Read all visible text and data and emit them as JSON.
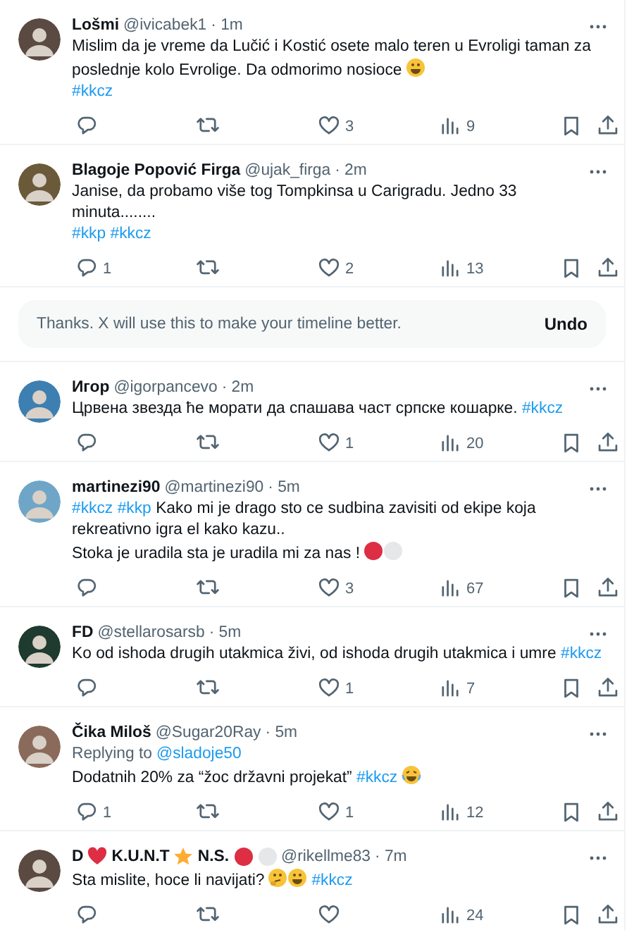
{
  "timeline": [
    {
      "kind": "tweet",
      "name": [
        {
          "kind": "text",
          "text": "Lošmi"
        }
      ],
      "handle": "@ivicabek1",
      "time": "· 1m",
      "body": [
        {
          "kind": "text",
          "text": "Mislim da je vreme da Lučić i Kostić osete malo teren u Evroligi taman za poslednje kolo Evrolige. Da odmorimo nosioce"
        },
        {
          "kind": "smiley"
        },
        {
          "kind": "break"
        },
        {
          "kind": "tag",
          "text": "#kkcz"
        }
      ],
      "actions": {
        "likes": "3",
        "views": "9"
      }
    },
    {
      "kind": "tweet",
      "name": [
        {
          "kind": "text",
          "text": "Blagoje Popović Firga"
        }
      ],
      "handle": "@ujak_firga",
      "time": "· 2m",
      "body": [
        {
          "kind": "text",
          "text": "Janise, da probamo više tog Tompkinsa u Carigradu. Jedno 33 minuta........"
        },
        {
          "kind": "break"
        },
        {
          "kind": "tag",
          "text": "#kkp"
        },
        {
          "kind": "tag",
          "text": "#kkcz"
        }
      ],
      "actions": {
        "replies": "1",
        "likes": "2",
        "views": "13"
      }
    },
    {
      "kind": "notice",
      "text": "Thanks. X will use this to make your timeline better.",
      "button": "Undo"
    },
    {
      "kind": "tweet",
      "name": [
        {
          "kind": "text",
          "text": "Игор"
        }
      ],
      "handle": "@igorpancevo",
      "time": "· 2m",
      "body": [
        {
          "kind": "text",
          "text": "Црвена звезда ће морати да спашава част српске кошарке."
        },
        {
          "kind": "tag",
          "text": "#kkcz"
        }
      ],
      "actions": {
        "likes": "1",
        "views": "20"
      }
    },
    {
      "kind": "tweet",
      "name": [
        {
          "kind": "text",
          "text": "martinezi90"
        }
      ],
      "handle": "@martinezi90",
      "time": "· 5m",
      "body": [
        {
          "kind": "tag",
          "text": "#kkcz"
        },
        {
          "kind": "tag",
          "text": "#kkp"
        },
        {
          "kind": "text",
          "text": "Kako mi je drago sto ce sudbina zavisiti od ekipe koja rekreativno igra el kako kazu..\nStoka je uradila sta je uradila mi za nas !"
        },
        {
          "kind": "reddot"
        },
        {
          "kind": "whitedot"
        }
      ],
      "actions": {
        "likes": "3",
        "views": "67"
      }
    },
    {
      "kind": "tweet",
      "name": [
        {
          "kind": "text",
          "text": "FD"
        }
      ],
      "handle": "@stellarosarsb",
      "time": "· 5m",
      "body": [
        {
          "kind": "text",
          "text": "Ko od ishoda drugih utakmica živi, od ishoda drugih utakmica i umre"
        },
        {
          "kind": "tag",
          "text": "#kkcz"
        }
      ],
      "actions": {
        "likes": "1",
        "views": "7"
      }
    },
    {
      "kind": "tweet",
      "name": [
        {
          "kind": "text",
          "text": "Čika Miloš"
        }
      ],
      "handle": "@Sugar20Ray",
      "time": "· 5m",
      "reply_label": "Replying to",
      "reply_to": "@sladoje50",
      "body": [
        {
          "kind": "text",
          "text": "Dodatnih 20% za “žoc državni projekat”"
        },
        {
          "kind": "tag",
          "text": "#kkcz"
        },
        {
          "kind": "laughing"
        }
      ],
      "actions": {
        "replies": "1",
        "likes": "1",
        "views": "12"
      }
    },
    {
      "kind": "tweet",
      "name": [
        {
          "kind": "text",
          "text": "D"
        },
        {
          "kind": "heart"
        },
        {
          "kind": "text",
          "text": "K.U.N.T"
        },
        {
          "kind": "star"
        },
        {
          "kind": "text",
          "text": "N.S."
        },
        {
          "kind": "reddot"
        },
        {
          "kind": "whitedot"
        }
      ],
      "handle": "@rikellme83",
      "time": "· 7m",
      "body": [
        {
          "kind": "text",
          "text": "Sta mislite, hoce li navijati?"
        },
        {
          "kind": "thinking"
        },
        {
          "kind": "smiley"
        },
        {
          "kind": "tag",
          "text": "#kkcz"
        }
      ],
      "actions": {
        "views": "24"
      }
    }
  ]
}
